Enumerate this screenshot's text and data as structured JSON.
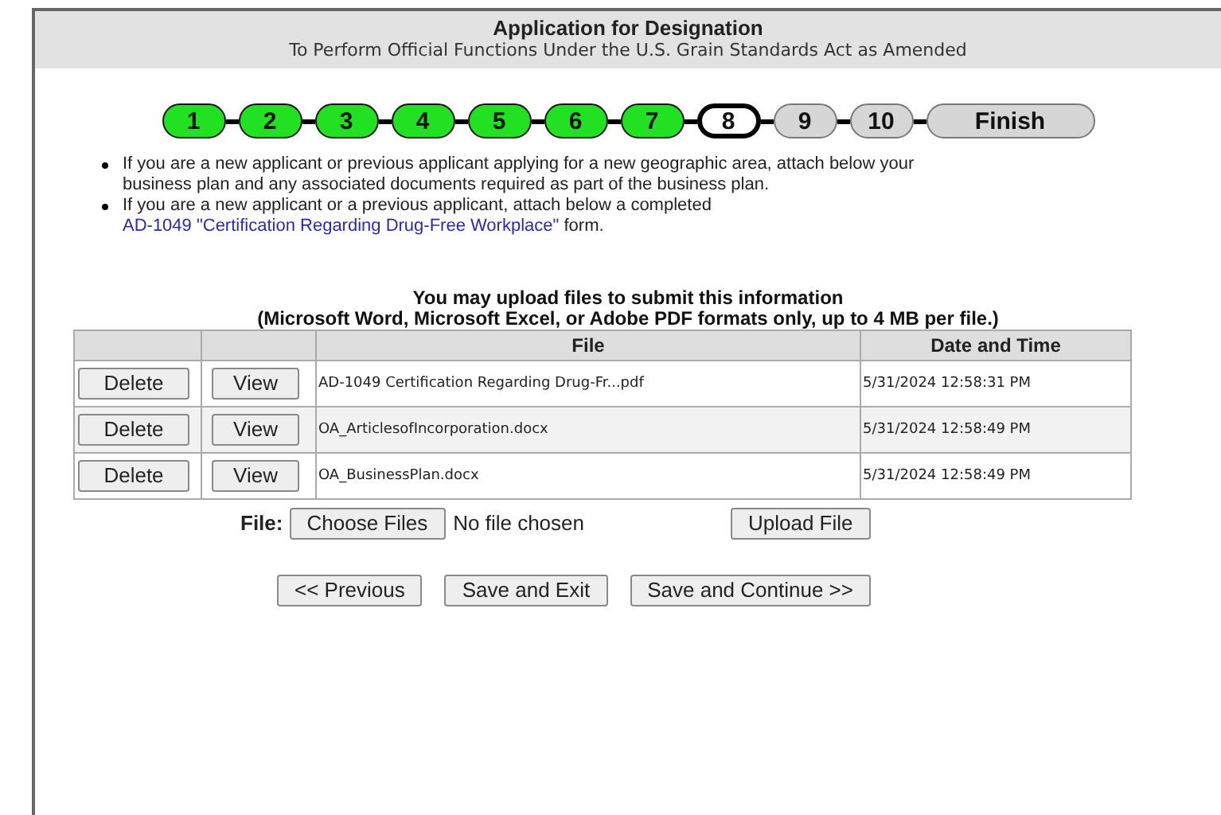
{
  "header": {
    "title": "Application for Designation",
    "subtitle": "To Perform Official Functions Under the U.S. Grain Standards Act as Amended"
  },
  "steps": [
    {
      "label": "1",
      "kind": "done"
    },
    {
      "label": "2",
      "kind": "done"
    },
    {
      "label": "3",
      "kind": "done"
    },
    {
      "label": "4",
      "kind": "done"
    },
    {
      "label": "5",
      "kind": "done"
    },
    {
      "label": "6",
      "kind": "done"
    },
    {
      "label": "7",
      "kind": "done"
    },
    {
      "label": "8",
      "kind": "current"
    },
    {
      "label": "9",
      "kind": "todo"
    },
    {
      "label": "10",
      "kind": "todo"
    },
    {
      "label": "Finish",
      "kind": "todo"
    }
  ],
  "instructions": [
    {
      "text": "If you are a new applicant or previous applicant applying for a new geographic area, attach below your business plan and any associated documents required as part of the business plan."
    },
    {
      "text": "If you are a new applicant or a previous applicant, attach below a completed",
      "link": "AD-1049 \"Certification Regarding Drug-Free Workplace\"",
      "after": "form."
    }
  ],
  "upload_heading": "You may upload files to submit this information",
  "upload_note": "(Microsoft Word, Microsoft Excel, or Adobe PDF formats only, up to 4 MB per file.)",
  "table": {
    "columns": [
      "File",
      "Date and Time"
    ],
    "rows": [
      {
        "delete": "Delete",
        "view": "View",
        "file": "AD-1049 Certification Regarding Drug-Fr...pdf",
        "date": "5/31/2024 12:58:31 PM"
      },
      {
        "delete": "Delete",
        "view": "View",
        "file": "OA_ArticlesofIncorporation.docx",
        "date": "5/31/2024 12:58:49 PM"
      },
      {
        "delete": "Delete",
        "view": "View",
        "file": "OA_BusinessPlan.docx",
        "date": "5/31/2024 12:58:49 PM"
      }
    ]
  },
  "file_picker": {
    "label": "File:",
    "button": "Choose Files",
    "status": "No file chosen",
    "upload": "Upload File"
  },
  "nav_buttons": [
    "<< Previous",
    "Save and Exit",
    "Save and Continue >>"
  ]
}
